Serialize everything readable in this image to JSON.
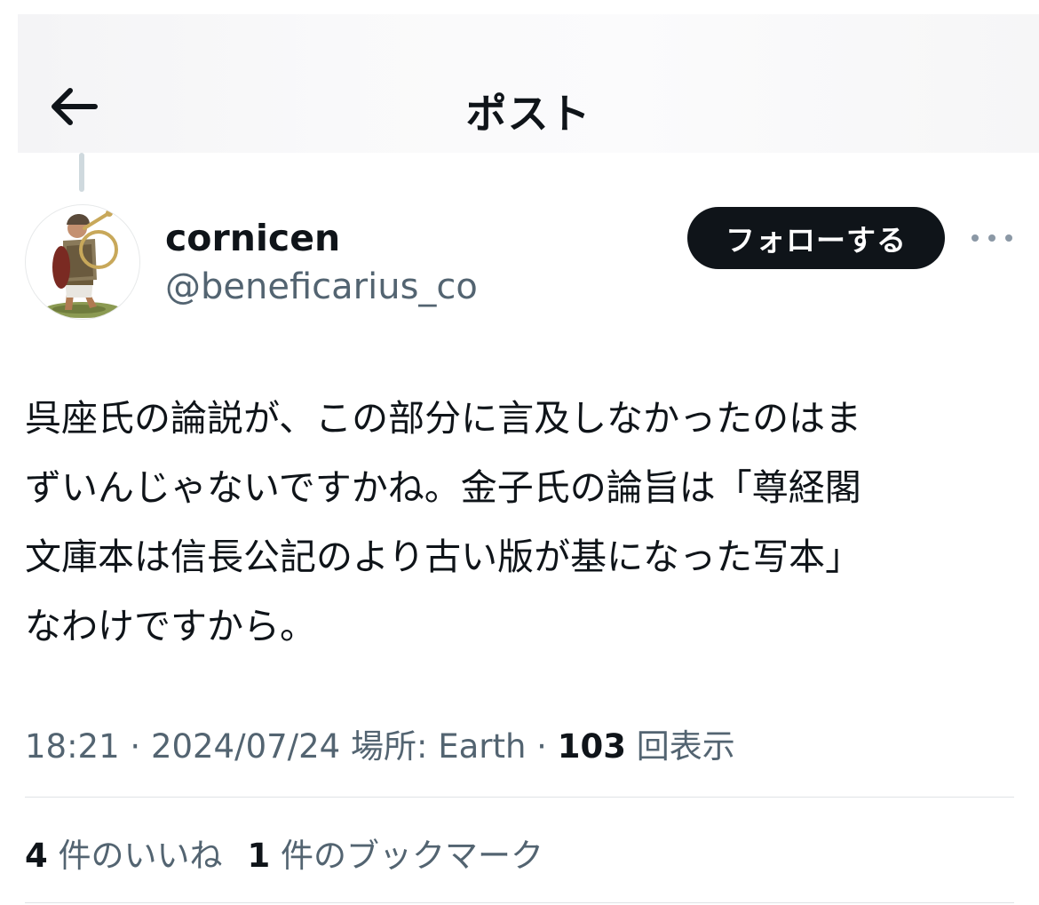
{
  "header": {
    "title": "ポスト",
    "back_icon": "arrow-left-icon"
  },
  "author": {
    "display_name": "cornicen",
    "handle": "@beneficarius_co",
    "avatar_icon": "roman-cornicen-avatar"
  },
  "actions": {
    "follow_label": "フォローする",
    "more_icon": "ellipsis-icon"
  },
  "post": {
    "lines": [
      "呉座氏の論説が、この部分に言及しなかったのはま",
      "ずいんじゃないですかね。金子氏の論旨は「尊経閣",
      "文庫本は信長公記のより古い版が基になった写本」",
      "なわけですから。"
    ]
  },
  "meta": {
    "time": "18:21",
    "sep1": " · ",
    "date": "2024/07/24",
    "location": "場所: Earth",
    "sep2": " · ",
    "views_count": "103",
    "views_label": "回表示"
  },
  "stats": {
    "likes_count": "4",
    "likes_label": "件のいいね",
    "bookmarks_count": "1",
    "bookmarks_label": "件のブックマーク"
  },
  "colors": {
    "text_primary": "#0f1419",
    "text_secondary": "#536471",
    "follow_bg": "#0f1419"
  }
}
